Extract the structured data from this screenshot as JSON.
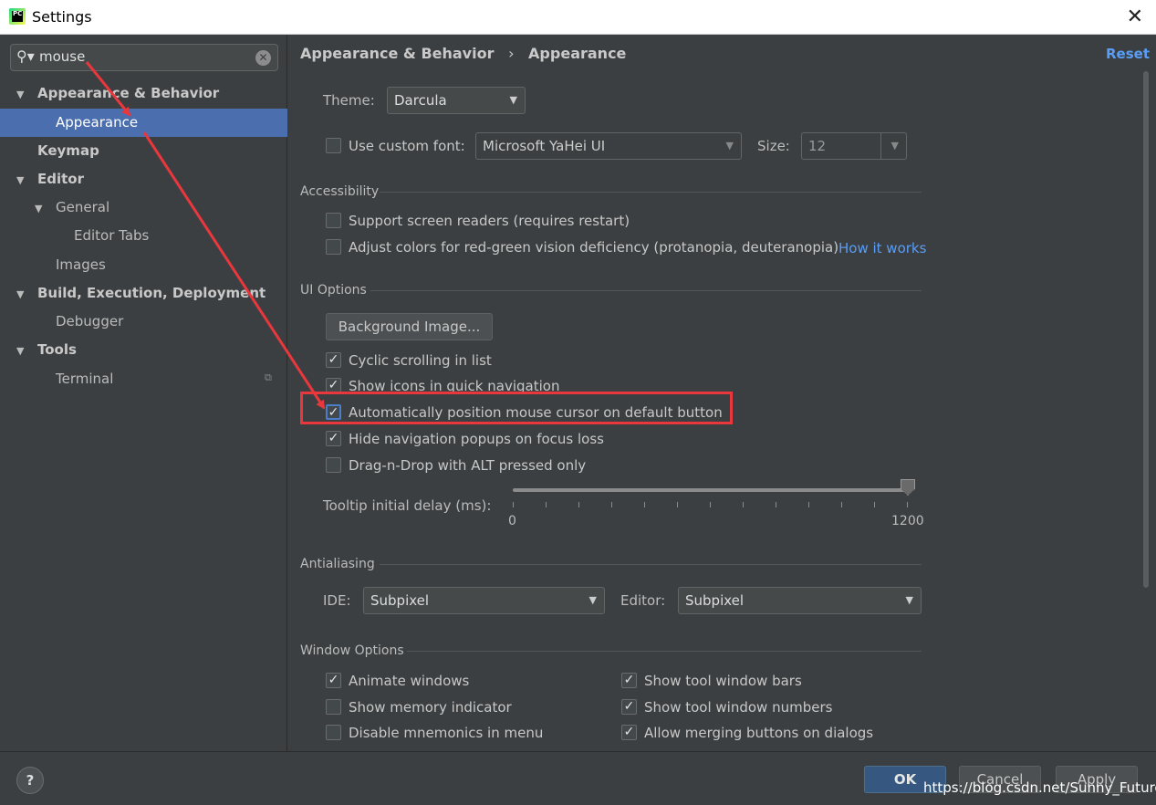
{
  "window": {
    "title": "Settings",
    "app_icon_text": "PC"
  },
  "search": {
    "value": "mouse"
  },
  "sidebar": {
    "items": [
      {
        "label": "Appearance & Behavior"
      },
      {
        "label": "Appearance"
      },
      {
        "label": "Keymap"
      },
      {
        "label": "Editor"
      },
      {
        "label": "General"
      },
      {
        "label": "Editor Tabs"
      },
      {
        "label": "Images"
      },
      {
        "label": "Build, Execution, Deployment"
      },
      {
        "label": "Debugger"
      },
      {
        "label": "Tools"
      },
      {
        "label": "Terminal"
      }
    ]
  },
  "breadcrumb": {
    "parent": "Appearance & Behavior",
    "separator": "›",
    "current": "Appearance"
  },
  "reset_label": "Reset",
  "theme": {
    "label": "Theme:",
    "value": "Darcula"
  },
  "font": {
    "checkbox_label": "Use custom font:",
    "checked": false,
    "value": "Microsoft YaHei UI",
    "size_label": "Size:",
    "size_value": "12"
  },
  "accessibility": {
    "title": "Accessibility",
    "screen_readers": "Support screen readers (requires restart)",
    "adjust_colors": "Adjust colors for red-green vision deficiency (protanopia, deuteranopia)",
    "how_it_works": "How it works"
  },
  "ui_options": {
    "title": "UI Options",
    "background_image_button": "Background Image...",
    "checkboxes": [
      {
        "label": "Cyclic scrolling in list",
        "checked": true
      },
      {
        "label": "Show icons in quick navigation",
        "checked": true
      },
      {
        "label": "Automatically position mouse cursor on default button",
        "checked": true
      },
      {
        "label": "Hide navigation popups on focus loss",
        "checked": true
      },
      {
        "label": "Drag-n-Drop with ALT pressed only",
        "checked": false
      }
    ],
    "tooltip_label": "Tooltip initial delay (ms):",
    "tooltip_min": "0",
    "tooltip_max": "1200",
    "tooltip_value": 1200
  },
  "antialiasing": {
    "title": "Antialiasing",
    "ide_label": "IDE:",
    "ide_value": "Subpixel",
    "editor_label": "Editor:",
    "editor_value": "Subpixel"
  },
  "window_options": {
    "title": "Window Options",
    "left": [
      {
        "label": "Animate windows",
        "checked": true
      },
      {
        "label": "Show memory indicator",
        "checked": false
      },
      {
        "label": "Disable mnemonics in menu",
        "checked": false
      }
    ],
    "right": [
      {
        "label": "Show tool window bars",
        "checked": true
      },
      {
        "label": "Show tool window numbers",
        "checked": true
      },
      {
        "label": "Allow merging buttons on dialogs",
        "checked": true
      }
    ]
  },
  "footer": {
    "help": "?",
    "ok": "OK",
    "cancel": "Cancel",
    "apply": "Apply"
  },
  "watermark": "https://blog.csdn.net/Sunny_Future",
  "colors": {
    "accent": "#4b6eaf",
    "link": "#589df6",
    "annotation": "#e8373d",
    "ok_button": "#365880"
  }
}
